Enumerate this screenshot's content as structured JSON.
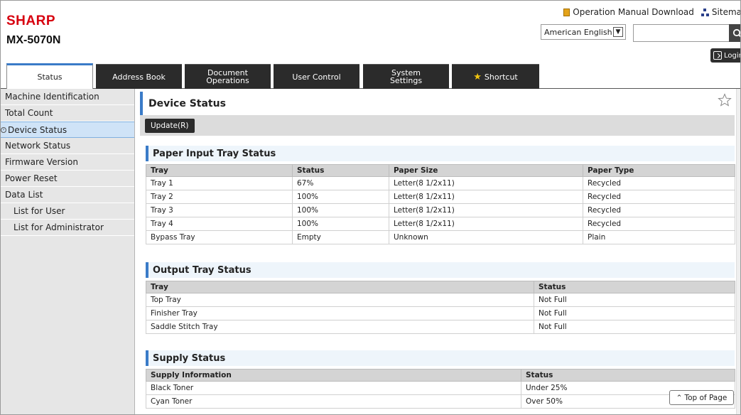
{
  "header": {
    "brand": "SHARP",
    "model": "MX-5070N",
    "manual_link": "Operation Manual Download",
    "sitemap_link": "Sitema",
    "language_value": "American English",
    "search_value": "",
    "login_label": "Login"
  },
  "tabs": [
    {
      "label": "Status",
      "active": true
    },
    {
      "label": "Address Book"
    },
    {
      "label": "Document\nOperations"
    },
    {
      "label": "User Control"
    },
    {
      "label": "System\nSettings"
    },
    {
      "label": "Shortcut"
    }
  ],
  "sidebar": {
    "items": [
      {
        "label": "Machine Identification"
      },
      {
        "label": "Total Count"
      },
      {
        "label": "Device Status",
        "active": true
      },
      {
        "label": "Network Status"
      },
      {
        "label": "Firmware Version"
      },
      {
        "label": "Power Reset"
      },
      {
        "label": "Data List"
      },
      {
        "label": "List for User",
        "sub": true
      },
      {
        "label": "List for Administrator",
        "sub": true
      }
    ]
  },
  "main": {
    "title": "Device Status",
    "update_button": "Update(R)",
    "paper_input": {
      "title": "Paper Input Tray Status",
      "headers": [
        "Tray",
        "Status",
        "Paper Size",
        "Paper Type"
      ],
      "rows": [
        [
          "Tray 1",
          "67%",
          "Letter(8 1/2x11)",
          "Recycled"
        ],
        [
          "Tray 2",
          "100%",
          "Letter(8 1/2x11)",
          "Recycled"
        ],
        [
          "Tray 3",
          "100%",
          "Letter(8 1/2x11)",
          "Recycled"
        ],
        [
          "Tray 4",
          "100%",
          "Letter(8 1/2x11)",
          "Recycled"
        ],
        [
          "Bypass Tray",
          "Empty",
          "Unknown",
          "Plain"
        ]
      ]
    },
    "output_tray": {
      "title": "Output Tray Status",
      "headers": [
        "Tray",
        "Status"
      ],
      "rows": [
        [
          "Top Tray",
          "Not Full"
        ],
        [
          "Finisher Tray",
          "Not Full"
        ],
        [
          "Saddle Stitch Tray",
          "Not Full"
        ]
      ]
    },
    "supply": {
      "title": "Supply Status",
      "headers": [
        "Supply Information",
        "Status"
      ],
      "rows": [
        [
          "Black Toner",
          "Under 25%"
        ],
        [
          "Cyan Toner",
          "Over 50%"
        ]
      ]
    }
  },
  "top_of_page_label": "Top of Page",
  "colors": {
    "brand_red": "#d7000f",
    "accent_blue": "#3a7bc8",
    "dark_button": "#2b2b2b"
  }
}
